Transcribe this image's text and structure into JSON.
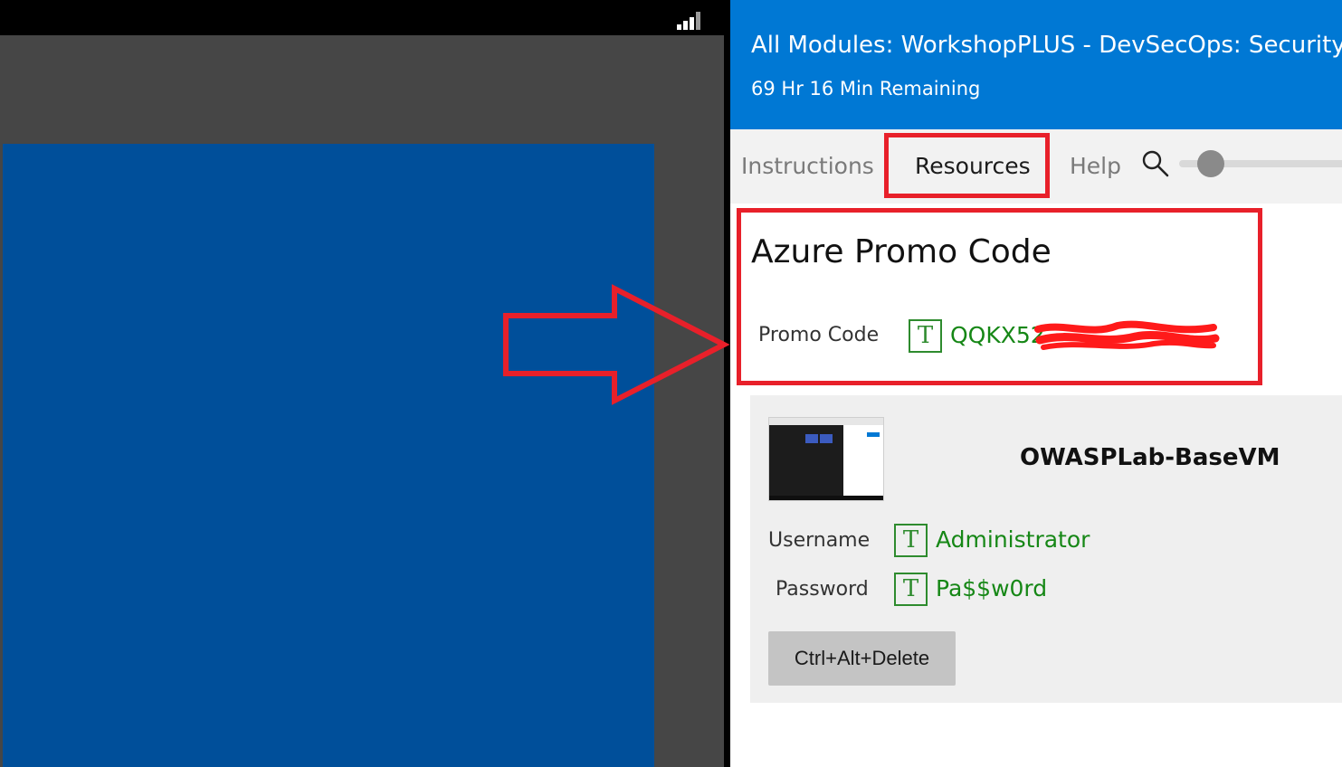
{
  "lab": {
    "title": "All Modules: WorkshopPLUS - DevSecOps: Security D",
    "time_remaining": "69 Hr 16 Min Remaining"
  },
  "tabs": [
    {
      "label": "Instructions",
      "selected": false
    },
    {
      "label": "Resources",
      "selected": true
    },
    {
      "label": "Help",
      "selected": false
    }
  ],
  "zoom": {
    "level": 0.2
  },
  "promo": {
    "heading": "Azure Promo Code",
    "label": "Promo Code",
    "value_visible": "QQKX52",
    "copy_icon": "T"
  },
  "vm": {
    "name": "OWASPLab-BaseVM",
    "username_label": "Username",
    "username_value": "Administrator",
    "password_label": "Password",
    "password_value": "Pa$$w0rd",
    "copy_icon": "T",
    "ctrl_alt_delete_label": "Ctrl+Alt+Delete"
  },
  "colors": {
    "header_blue": "#0078d4",
    "vm_screen_blue": "#004f9a",
    "highlight_red": "#e8202a",
    "value_green": "#168716"
  },
  "icons": [
    "signal-bars-icon",
    "search-icon",
    "text-type-icon",
    "annotation-arrow"
  ]
}
